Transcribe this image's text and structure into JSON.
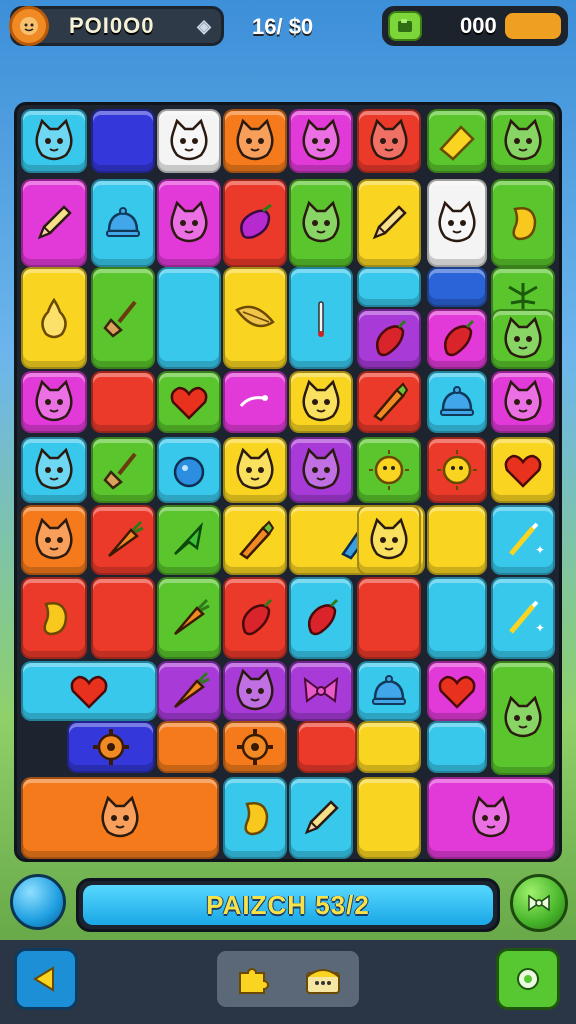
{
  "hud": {
    "player_name": "POI0O0",
    "moves": "16/ $0",
    "coins": "000",
    "coin_fill_fraction": 0.3
  },
  "status": {
    "text": "PAIZCH 53/2"
  },
  "colors": {
    "red": "#ec3a2a",
    "orange": "#f47a1c",
    "yellow": "#f9d522",
    "green": "#5ac52c",
    "cyan": "#37c8ec",
    "blue": "#2b63d8",
    "purple": "#a83ad8",
    "magenta": "#e23ad8",
    "white": "#f4f4f4",
    "navy": "#3437d9",
    "pink": "#f04fb6"
  },
  "board": {
    "tiles": [
      {
        "c": "cyan",
        "icon": "cat-face-icon"
      },
      {
        "c": "navy",
        "icon": ""
      },
      {
        "c": "white",
        "icon": "cat-face-icon"
      },
      {
        "c": "orange",
        "icon": "cat-face-icon"
      },
      {
        "c": "magenta",
        "icon": "cat-face-icon"
      },
      {
        "c": "red",
        "icon": "cat-face-icon"
      },
      {
        "c": "green",
        "icon": "cheese-icon"
      },
      {
        "c": "green",
        "icon": "cat-face-icon"
      },
      {
        "c": "magenta",
        "icon": "pencil-icon"
      },
      {
        "c": "cyan",
        "icon": "bell-icon"
      },
      {
        "c": "magenta",
        "icon": "cat-face-icon"
      },
      {
        "c": "red",
        "icon": "eggplant-icon"
      },
      {
        "c": "green",
        "icon": "cat-face-icon"
      },
      {
        "c": "yellow",
        "icon": "pencil-icon"
      },
      {
        "c": "white",
        "icon": "cat-face-icon"
      },
      {
        "c": "green",
        "icon": "mango-icon"
      },
      {
        "c": "yellow",
        "icon": "pear-icon"
      },
      {
        "c": "green",
        "icon": "shovel-icon"
      },
      {
        "c": "cyan",
        "icon": ""
      },
      {
        "c": "yellow",
        "icon": "corn-icon"
      },
      {
        "c": "cyan",
        "icon": "stick-icon"
      },
      {
        "c": "cyan",
        "icon": ""
      },
      {
        "c": "blue",
        "icon": ""
      },
      {
        "c": "green",
        "icon": "leaf-icon"
      },
      {
        "c": "purple",
        "icon": "pepper-icon"
      },
      {
        "c": "magenta",
        "icon": "pepper-icon"
      },
      {
        "c": "green",
        "icon": "cat-face-icon"
      },
      {
        "c": "magenta",
        "icon": "cat-face-icon"
      },
      {
        "c": "red",
        "icon": ""
      },
      {
        "c": "green",
        "icon": "heart-icon"
      },
      {
        "c": "magenta",
        "icon": "swirl-icon"
      },
      {
        "c": "yellow",
        "icon": "cat-face-icon"
      },
      {
        "c": "red",
        "icon": "crayon-icon"
      },
      {
        "c": "cyan",
        "icon": "bell-icon"
      },
      {
        "c": "magenta",
        "icon": "cat-face-icon"
      },
      {
        "c": "cyan",
        "icon": "cat-face-icon"
      },
      {
        "c": "green",
        "icon": "shovel-icon"
      },
      {
        "c": "cyan",
        "icon": "ball-icon"
      },
      {
        "c": "yellow",
        "icon": "cat-face-icon"
      },
      {
        "c": "purple",
        "icon": "cat-face-icon"
      },
      {
        "c": "green",
        "icon": "sun-face-icon"
      },
      {
        "c": "red",
        "icon": "sun-face-icon"
      },
      {
        "c": "yellow",
        "icon": "heart-icon"
      },
      {
        "c": "orange",
        "icon": "cat-face-icon"
      },
      {
        "c": "red",
        "icon": "carrot-icon"
      },
      {
        "c": "green",
        "icon": "arrow-icon"
      },
      {
        "c": "yellow",
        "icon": "crayon-icon"
      },
      {
        "c": "yellow",
        "icon": "tube-icon"
      },
      {
        "c": "yellow",
        "icon": "cat-face-icon"
      },
      {
        "c": "yellow",
        "icon": ""
      },
      {
        "c": "cyan",
        "icon": "wand-icon"
      },
      {
        "c": "red",
        "icon": "mango-icon"
      },
      {
        "c": "red",
        "icon": ""
      },
      {
        "c": "green",
        "icon": "carrot-icon"
      },
      {
        "c": "red",
        "icon": "pepper-icon"
      },
      {
        "c": "cyan",
        "icon": "pepper-icon"
      },
      {
        "c": "red",
        "icon": ""
      },
      {
        "c": "cyan",
        "icon": ""
      },
      {
        "c": "cyan",
        "icon": "wand-icon"
      },
      {
        "c": "cyan",
        "icon": "heart-icon"
      },
      {
        "c": "purple",
        "icon": "carrot-icon"
      },
      {
        "c": "purple",
        "icon": "cat-face-icon"
      },
      {
        "c": "purple",
        "icon": "bow-icon"
      },
      {
        "c": "cyan",
        "icon": "bell-icon"
      },
      {
        "c": "magenta",
        "icon": "heart-icon"
      },
      {
        "c": "green",
        "icon": "cat-face-icon"
      },
      {
        "c": "navy",
        "icon": "gear-icon"
      },
      {
        "c": "orange",
        "icon": ""
      },
      {
        "c": "orange",
        "icon": "gear-icon"
      },
      {
        "c": "red",
        "icon": ""
      },
      {
        "c": "yellow",
        "icon": ""
      },
      {
        "c": "cyan",
        "icon": ""
      },
      {
        "c": "orange",
        "icon": "cat-face-icon"
      },
      {
        "c": "cyan",
        "icon": "mango-icon"
      },
      {
        "c": "cyan",
        "icon": "pencil-icon"
      },
      {
        "c": "yellow",
        "icon": ""
      },
      {
        "c": "magenta",
        "icon": "cat-face-icon"
      }
    ]
  }
}
